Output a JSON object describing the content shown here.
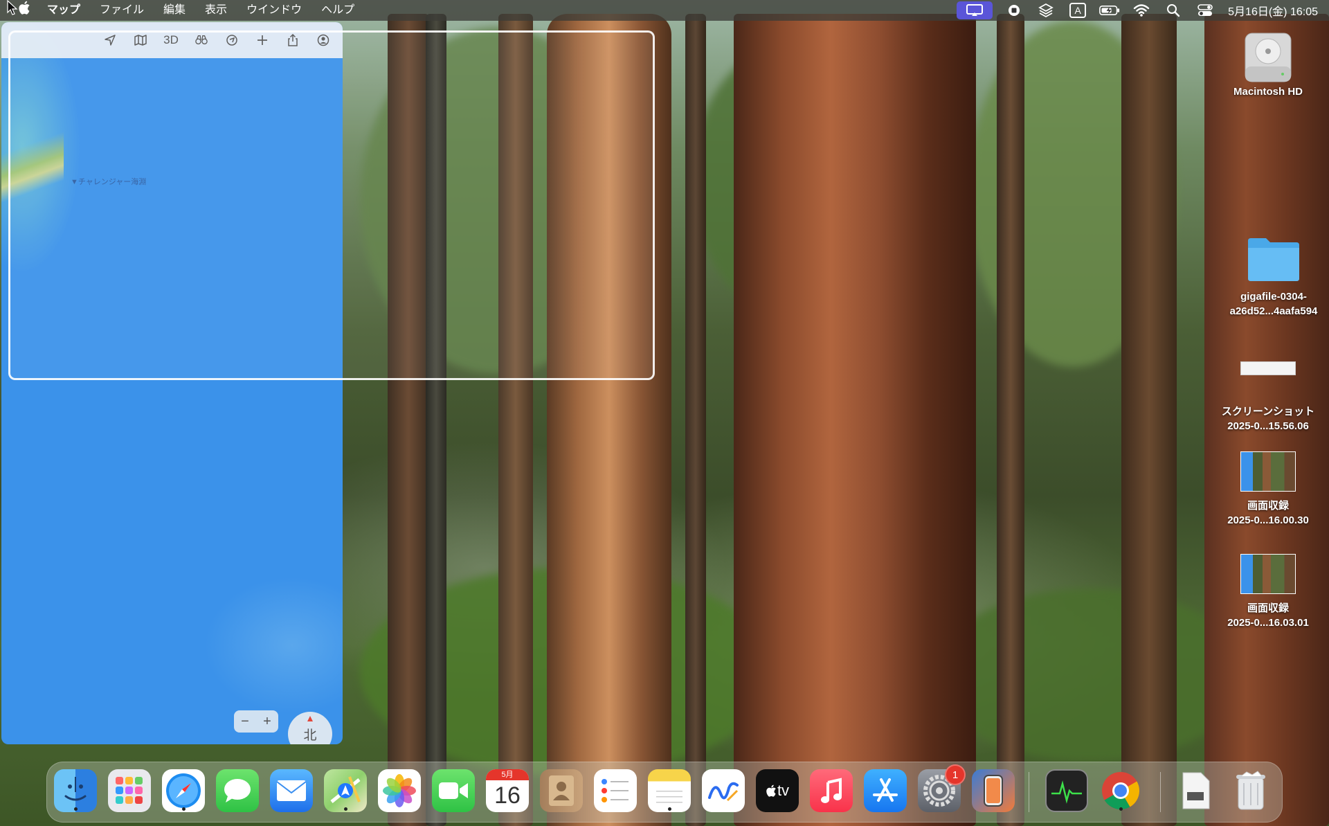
{
  "menubar": {
    "apple": "",
    "items": [
      "マップ",
      "ファイル",
      "編集",
      "表示",
      "ウインドウ",
      "ヘルプ"
    ],
    "input_source": "A",
    "clock": "5月16日(金) 16:05"
  },
  "maps": {
    "toolbar": {
      "three_d": "3D"
    },
    "labels": {
      "challenger_deep": "▼チャレンジャー海淵"
    },
    "compass_label": "北",
    "zoom_out": "−",
    "zoom_in": "+"
  },
  "desktop": {
    "macintosh_hd": "Macintosh HD",
    "folder_line1": "gigafile-0304-",
    "folder_line2": "a26d52...4aafa594",
    "screenshot_line1": "スクリーンショット",
    "screenshot_line2": "2025-0...15.56.06",
    "recording1_line1": "画面収録",
    "recording1_line2": "2025-0...16.00.30",
    "recording2_line1": "画面収録",
    "recording2_line2": "2025-0...16.03.01"
  },
  "dock": {
    "calendar_month": "5月",
    "calendar_day": "16",
    "tv_label": "tv",
    "settings_badge": "1"
  }
}
